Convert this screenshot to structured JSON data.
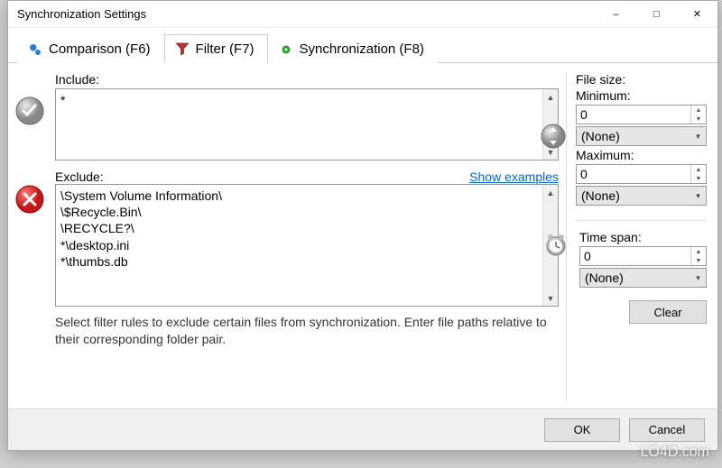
{
  "window": {
    "title": "Synchronization Settings"
  },
  "tabs": {
    "comparison": "Comparison (F6)",
    "filter": "Filter (F7)",
    "synchronization": "Synchronization (F8)"
  },
  "include": {
    "label": "Include:",
    "value": "*"
  },
  "exclude": {
    "label": "Exclude:",
    "show_examples": "Show examples",
    "value": "\\System Volume Information\\\n\\$Recycle.Bin\\\n\\RECYCLE?\\\n*\\desktop.ini\n*\\thumbs.db"
  },
  "filesize": {
    "label": "File size:",
    "min_label": "Minimum:",
    "min_value": "0",
    "min_unit": "(None)",
    "max_label": "Maximum:",
    "max_value": "0",
    "max_unit": "(None)"
  },
  "timespan": {
    "label": "Time span:",
    "value": "0",
    "unit": "(None)"
  },
  "buttons": {
    "clear": "Clear",
    "ok": "OK",
    "cancel": "Cancel"
  },
  "hint": "Select filter rules to exclude certain files from synchronization. Enter file paths relative to their corresponding folder pair.",
  "watermark": "LO4D.com"
}
